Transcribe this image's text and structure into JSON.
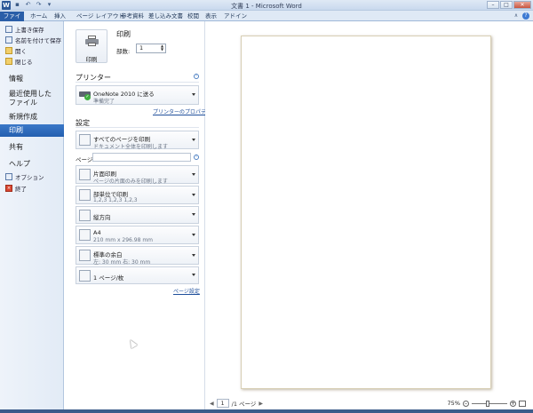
{
  "window": {
    "title": "文書 1 - Microsoft Word",
    "app_letter": "W"
  },
  "qat": {
    "save": "▪",
    "undo": "↶",
    "redo": "↷",
    "customize": "▾"
  },
  "window_controls": {
    "min": "–",
    "max": "□",
    "close": "✕"
  },
  "ribbon_tabs": [
    "ファイル",
    "ホーム",
    "挿入",
    "ページ レイアウト",
    "参考資料",
    "差し込み文書",
    "校閲",
    "表示",
    "アドイン"
  ],
  "ribbon_right": {
    "min": "∧",
    "help": "?"
  },
  "backstage": {
    "commands": [
      {
        "label": "上書き保存",
        "icon": "save-icon"
      },
      {
        "label": "名前を付けて保存",
        "icon": "save-as-icon"
      },
      {
        "label": "開く",
        "icon": "folder-open-icon"
      },
      {
        "label": "閉じる",
        "icon": "close-doc-icon"
      }
    ],
    "info": "情報",
    "recent": [
      "最近使用した",
      "ファイル"
    ],
    "new": "新規作成",
    "print": "印刷",
    "share": "共有",
    "help": "ヘルプ",
    "options": "オプション",
    "exit": "終了"
  },
  "print_panel": {
    "print_button": "印刷",
    "title": "印刷",
    "copies_label": "部数:",
    "copies_value": "1",
    "printer_heading": "プリンター",
    "printer_name": "OneNote 2010 に送る",
    "printer_status": "準備完了",
    "printer_properties": "プリンターのプロパティ",
    "settings_heading": "設定",
    "settings": [
      {
        "line1": "すべてのページを印刷",
        "line2": "ドキュメント全体を印刷します"
      },
      {
        "line1": "片面印刷",
        "line2": "ページの片面のみを印刷します"
      },
      {
        "line1": "部単位で印刷",
        "line2": "1,2,3    1,2,3    1,2,3"
      },
      {
        "line1": "縦方向",
        "line2": ""
      },
      {
        "line1": "A4",
        "line2": "210 mm x 296.98 mm"
      },
      {
        "line1": "標準の余白",
        "line2": "左:  30 mm    右:  30 mm"
      },
      {
        "line1": "1 ページ/枚",
        "line2": ""
      }
    ],
    "pages_label": "ページ:",
    "page_setup": "ページ設定"
  },
  "preview": {
    "current_page": "1",
    "total_pages": "/1 ページ",
    "zoom": "75%"
  }
}
